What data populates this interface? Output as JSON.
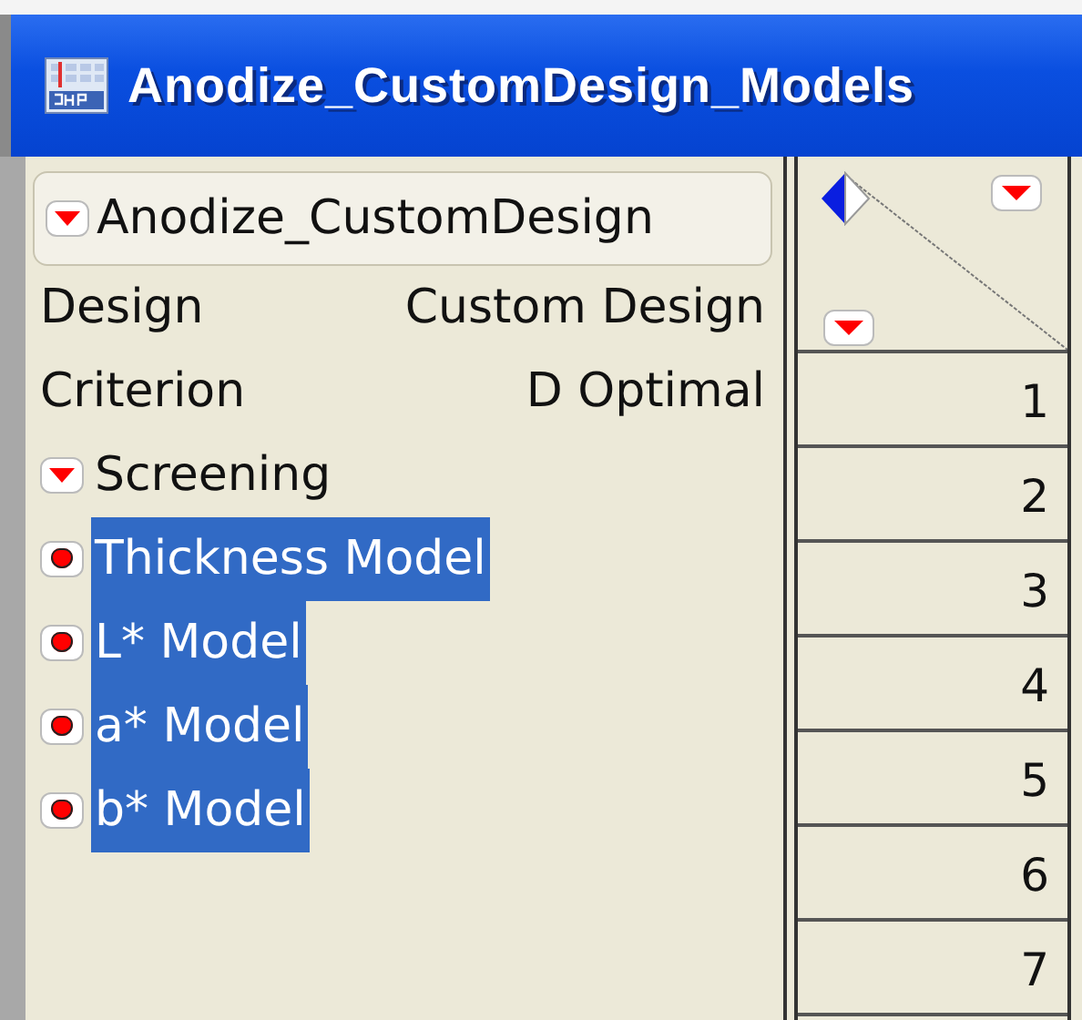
{
  "window": {
    "title": "Anodize_CustomDesign_Models"
  },
  "outline": {
    "title": "Anodize_CustomDesign",
    "expanded": true,
    "rows": [
      {
        "label": "Design",
        "value": "Custom Design"
      },
      {
        "label": "Criterion",
        "value": "D Optimal"
      }
    ],
    "nodes": [
      {
        "label": "Screening",
        "expanded": true,
        "selected": false
      },
      {
        "label": "Thickness Model",
        "expanded": false,
        "selected": true
      },
      {
        "label": "L* Model",
        "expanded": false,
        "selected": true
      },
      {
        "label": "a* Model",
        "expanded": false,
        "selected": true
      },
      {
        "label": "b* Model",
        "expanded": false,
        "selected": true
      }
    ]
  },
  "table": {
    "rows": [
      "1",
      "2",
      "3",
      "4",
      "5",
      "6",
      "7"
    ]
  }
}
